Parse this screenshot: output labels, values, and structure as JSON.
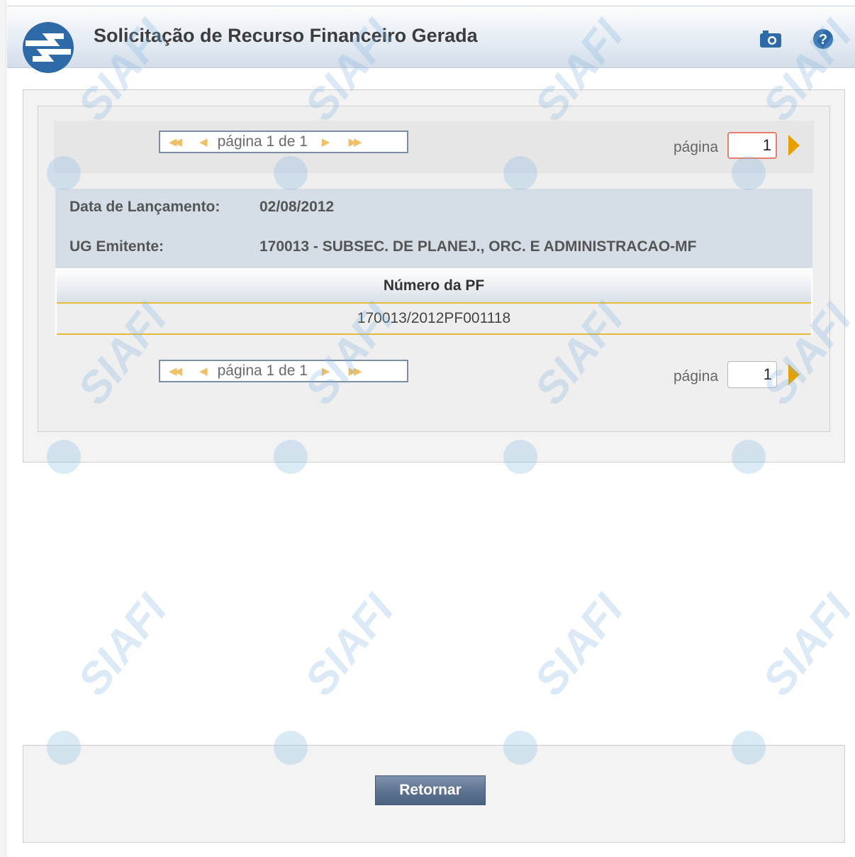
{
  "header": {
    "title": "Solicitação de Recurso Financeiro Gerada",
    "logo_icon": "siafi-logo-icon",
    "camera_icon": "camera-icon",
    "help_icon": "help-icon"
  },
  "pager_top": {
    "status": "página 1 de 1",
    "label": "página",
    "input_value": "1"
  },
  "pager_bottom": {
    "status": "página 1 de 1",
    "label": "página",
    "input_value": "1"
  },
  "details": {
    "data_lancamento_label": "Data de Lançamento:",
    "data_lancamento_value": "02/08/2012",
    "ug_label": "UG Emitente:",
    "ug_value": "170013 - SUBSEC. DE PLANEJ., ORC. E ADMINISTRACAO-MF"
  },
  "table": {
    "header": "Número da PF",
    "rows": [
      "170013/2012PF001118"
    ]
  },
  "footer": {
    "return_label": "Retornar"
  },
  "watermark_text": "SIAFI",
  "colors": {
    "accent": "#e8a000",
    "header_blue": "#2e6aa8",
    "button": "#5c7290",
    "row_border": "#e6bb38"
  }
}
